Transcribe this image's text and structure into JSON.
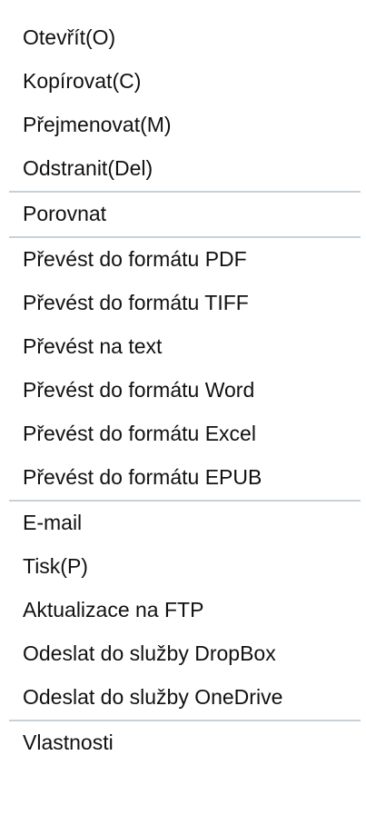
{
  "menu": {
    "items": [
      {
        "label": "Otevřít(O)"
      },
      {
        "label": "Kopírovat(C)"
      },
      {
        "label": "Přejmenovat(M)"
      },
      {
        "label": "Odstranit(Del)"
      },
      {
        "label": "Porovnat"
      },
      {
        "label": "Převést do formátu PDF"
      },
      {
        "label": "Převést do formátu TIFF"
      },
      {
        "label": "Převést na text"
      },
      {
        "label": "Převést do formátu Word"
      },
      {
        "label": "Převést do formátu Excel"
      },
      {
        "label": "Převést do formátu EPUB"
      },
      {
        "label": "E-mail"
      },
      {
        "label": "Tisk(P)"
      },
      {
        "label": "Aktualizace na FTP"
      },
      {
        "label": "Odeslat do služby DropBox"
      },
      {
        "label": "Odeslat do služby OneDrive"
      },
      {
        "label": "Vlastnosti"
      }
    ]
  },
  "colors": {
    "background": "#ffffff",
    "text": "#111111",
    "separator": "#c5d2dc"
  }
}
